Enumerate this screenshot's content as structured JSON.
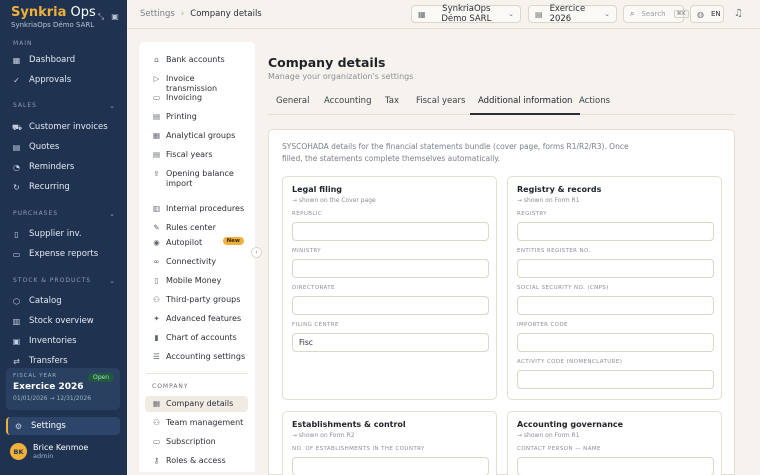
{
  "brand": {
    "name_part1": "Synkria",
    "name_part2": "Ops",
    "company": "SynkriaOps Démo SARL"
  },
  "sidebar": {
    "sections": {
      "main": "MAIN",
      "sales": "SALES",
      "purchases": "PURCHASES",
      "stock": "STOCK & PRODUCTS"
    },
    "items": {
      "dashboard": "Dashboard",
      "approvals": "Approvals",
      "customer_invoices": "Customer invoices",
      "quotes": "Quotes",
      "reminders": "Reminders",
      "recurring": "Recurring",
      "supplier_inv": "Supplier inv.",
      "expense_reports": "Expense reports",
      "catalog": "Catalog",
      "stock_overview": "Stock overview",
      "inventories": "Inventories",
      "transfers": "Transfers",
      "settings": "Settings"
    },
    "fiscal_year": {
      "label": "FISCAL YEAR",
      "status": "Open",
      "name": "Exercice 2026",
      "dates": "01/01/2026 → 12/31/2026"
    },
    "user": {
      "initials": "BK",
      "name": "Brice Kenmoe",
      "role": "admin"
    }
  },
  "topbar": {
    "breadcrumb": {
      "root": "Settings",
      "current": "Company details"
    },
    "company_selector": "SynkriaOps Démo SARL",
    "year_selector": "Exercice 2026",
    "search_placeholder": "Search",
    "search_shortcut": "⌘K",
    "language": "EN"
  },
  "settings_menu": {
    "items": [
      {
        "label": "Bank accounts",
        "icon": "bank-icon"
      },
      {
        "label": "Invoice transmission",
        "icon": "send-icon"
      },
      {
        "label": "Invoicing",
        "icon": "invoice-icon"
      },
      {
        "label": "Printing",
        "icon": "printer-icon"
      },
      {
        "label": "Analytical groups",
        "icon": "groups-icon"
      },
      {
        "label": "Fiscal years",
        "icon": "calendar-icon"
      },
      {
        "label": "Opening balance import",
        "icon": "upload-icon"
      },
      {
        "label": "Internal procedures",
        "icon": "procedure-icon"
      },
      {
        "label": "Rules center",
        "icon": "rules-icon"
      },
      {
        "label": "Autopilot",
        "icon": "bot-icon",
        "badge": "New"
      },
      {
        "label": "Connectivity",
        "icon": "link-icon"
      },
      {
        "label": "Mobile Money",
        "icon": "phone-icon"
      },
      {
        "label": "Third-party groups",
        "icon": "users-icon"
      },
      {
        "label": "Advanced features",
        "icon": "wrench-icon"
      },
      {
        "label": "Chart of accounts",
        "icon": "book-icon"
      },
      {
        "label": "Accounting settings",
        "icon": "sliders-icon"
      }
    ],
    "section_company": "COMPANY",
    "company_items": [
      {
        "label": "Company details",
        "icon": "building-icon",
        "active": true
      },
      {
        "label": "Team management",
        "icon": "team-icon"
      },
      {
        "label": "Subscription",
        "icon": "card-icon"
      },
      {
        "label": "Roles & access",
        "icon": "key-icon"
      }
    ]
  },
  "main": {
    "title": "Company details",
    "subtitle": "Manage your organization's settings",
    "tabs": [
      "General",
      "Accounting",
      "Tax",
      "Fiscal years",
      "Additional information",
      "Actions"
    ],
    "active_tab": "Additional information",
    "intro": "SYSCOHADA details for the financial statements bundle (cover page, forms R1/R2/R3). Once filled, the statements complete themselves automatically.",
    "panels": {
      "legal_filing": {
        "title": "Legal filing",
        "subtitle": "→ shown on the Cover page",
        "fields": [
          {
            "label": "REPUBLIC",
            "value": ""
          },
          {
            "label": "MINISTRY",
            "value": ""
          },
          {
            "label": "DIRECTORATE",
            "value": ""
          },
          {
            "label": "FILING CENTRE",
            "value": "Fisc"
          }
        ]
      },
      "registry": {
        "title": "Registry & records",
        "subtitle": "→ shown on Form R1",
        "fields": [
          {
            "label": "REGISTRY",
            "value": ""
          },
          {
            "label": "ENTITIES REGISTER NO.",
            "value": ""
          },
          {
            "label": "SOCIAL SECURITY NO. (CNPS)",
            "value": ""
          },
          {
            "label": "IMPORTER CODE",
            "value": ""
          },
          {
            "label": "ACTIVITY CODE (NOMENCLATURE)",
            "value": ""
          }
        ]
      },
      "establishments": {
        "title": "Establishments & control",
        "subtitle": "→ shown on Form R2",
        "fields": [
          {
            "label": "NO. OF ESTABLISHMENTS IN THE COUNTRY",
            "value": ""
          }
        ]
      },
      "governance": {
        "title": "Accounting governance",
        "subtitle": "→ shown on Form R1",
        "fields": [
          {
            "label": "CONTACT PERSON — NAME",
            "value": ""
          }
        ]
      }
    }
  },
  "colors": {
    "sidebar_bg": "#1f3350",
    "accent": "#f0b13a",
    "page_bg": "#f6f3ee"
  }
}
